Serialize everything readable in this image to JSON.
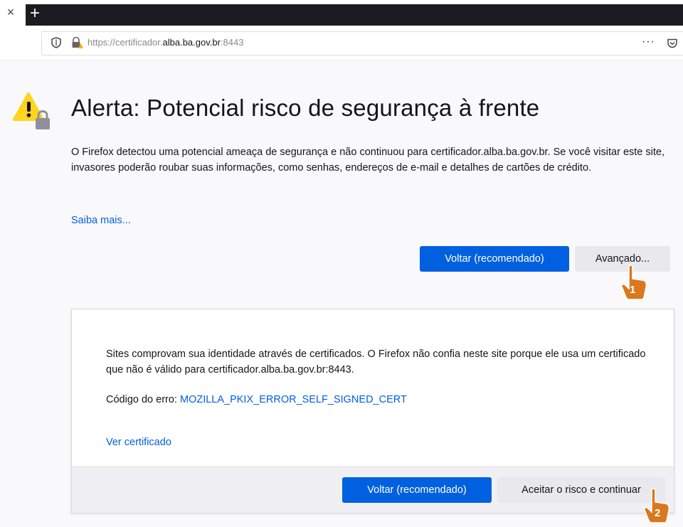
{
  "browser": {
    "tab_close_glyph": "×",
    "new_tab_glyph": "+",
    "url_prefix": "https://certificador.",
    "url_domain": "alba.ba.gov.br",
    "url_port": ":8443",
    "page_actions": "···"
  },
  "page": {
    "title": "Alerta: Potencial risco de segurança à frente",
    "description": "O Firefox detectou uma potencial ameaça de segurança e não continuou para certificador.alba.ba.gov.br. Se você visitar este site, invasores poderão roubar suas informações, como senhas, endereços de e-mail e detalhes de cartões de crédito.",
    "learn_more": "Saiba mais...",
    "back_button": "Voltar (recomendado)",
    "advanced_button": "Avançado..."
  },
  "advanced_panel": {
    "text": "Sites comprovam sua identidade através de certificados. O Firefox não confia neste site porque ele usa um certificado que não é válido para certificador.alba.ba.gov.br:8443.",
    "error_label": "Código do erro: ",
    "error_code": "MOZILLA_PKIX_ERROR_SELF_SIGNED_CERT",
    "view_certificate": "Ver certificado",
    "back_button": "Voltar (recomendado)",
    "accept_button": "Aceitar o risco e continuar"
  },
  "annotations": {
    "step1": "1",
    "step2": "2"
  },
  "colors": {
    "primary": "#0060df",
    "warning": "#ffd51e",
    "pointer": "#d9781e"
  },
  "icons": [
    "shield-icon",
    "insecure-lock-icon",
    "pocket-icon",
    "warning-icon",
    "hand-pointer-icon"
  ]
}
